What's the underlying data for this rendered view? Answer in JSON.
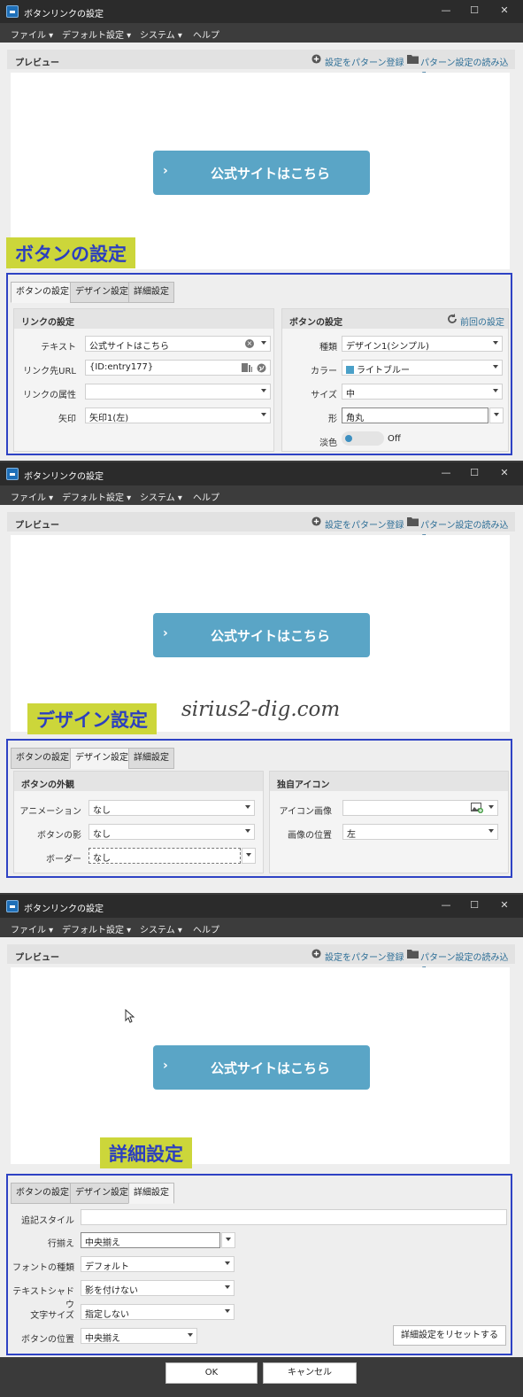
{
  "window": {
    "title": "ボタンリンクの設定",
    "controls": [
      "—",
      "☐",
      "✕"
    ]
  },
  "menu": [
    "ファイル ▾",
    "デフォルト設定 ▾",
    "システム ▾",
    "ヘルプ"
  ],
  "preview": {
    "label": "プレビュー",
    "save_pattern": "設定をパターン登録",
    "load_pattern": "パターン設定の読み込み",
    "cta_arrow": "›",
    "cta_text": "公式サイトはこちら"
  },
  "tabs": [
    "ボタンの設定",
    "デザイン設定",
    "詳細設定"
  ],
  "ribbons": {
    "s1": "ボタンの設定",
    "s2": "デザイン設定",
    "s3": "詳細設定"
  },
  "watermark": "sirius2-dig.com",
  "s1": {
    "link": {
      "title": "リンクの設定",
      "text_label": "テキスト",
      "text_value": "公式サイトはこちら",
      "url_label": "リンク先URL",
      "url_value": "{ID:entry177}",
      "attr_label": "リンクの属性",
      "attr_value": "",
      "arrow_label": "矢印",
      "arrow_value": "矢印1(左)"
    },
    "button": {
      "title": "ボタンの設定",
      "prev_label": "前回の設定",
      "type_label": "種類",
      "type_value": "デザイン1(シンプル)",
      "color_label": "カラー",
      "color_value": "ライトブルー",
      "size_label": "サイズ",
      "size_value": "中",
      "shape_label": "形",
      "shape_value": "角丸",
      "pale_label": "淡色",
      "pale_value": "Off"
    }
  },
  "s2": {
    "look": {
      "title": "ボタンの外観",
      "anim_label": "アニメーション",
      "anim_value": "なし",
      "shadow_label": "ボタンの影",
      "shadow_value": "なし",
      "border_label": "ボーダー",
      "border_value": "なし"
    },
    "icon": {
      "title": "独自アイコン",
      "image_label": "アイコン画像",
      "image_value": "",
      "pos_label": "画像の位置",
      "pos_value": "左"
    }
  },
  "s3": {
    "style_label": "追記スタイル",
    "style_value": "",
    "align_label": "行揃え",
    "align_value": "中央揃え",
    "font_label": "フォントの種類",
    "font_value": "デフォルト",
    "tshadow_label": "テキストシャドウ",
    "tshadow_value": "影を付けない",
    "fsize_label": "文字サイズ",
    "fsize_value": "指定しない",
    "bpos_label": "ボタンの位置",
    "bpos_value": "中央揃え",
    "reset_label": "詳細設定をリセットする"
  },
  "footer": {
    "ok": "OK",
    "cancel": "キャンセル"
  },
  "colors": {
    "cta": "#5aa5c6",
    "ribbon": "#ccd63a",
    "frame": "#2e42c4",
    "accent_link": "#2e6f97",
    "swatch_lightblue": "#4aa0c8"
  }
}
